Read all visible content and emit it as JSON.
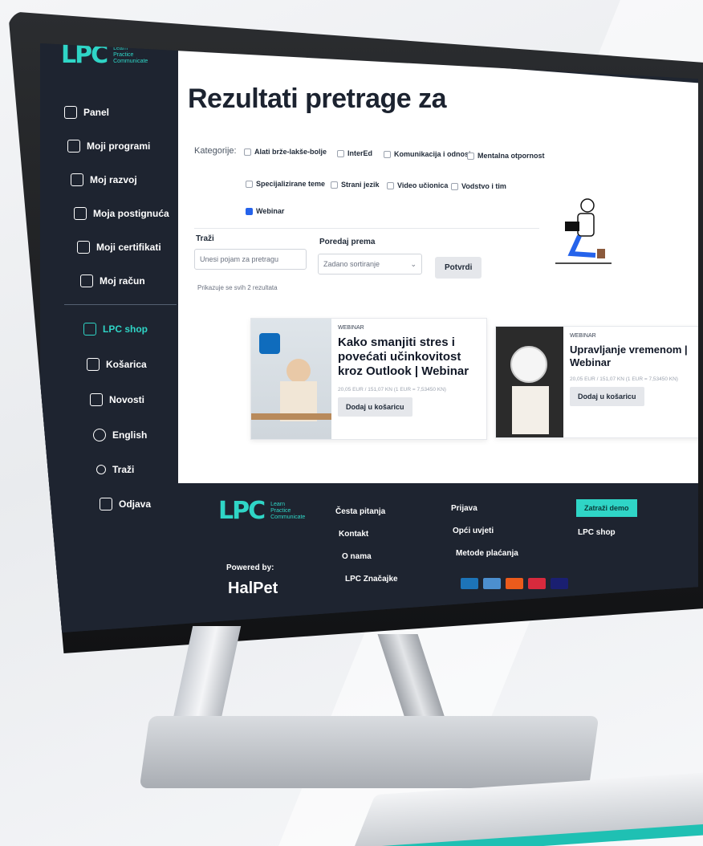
{
  "sidebar": {
    "logo_mark": "LPC",
    "logo_lines": [
      "Learn",
      "Practice",
      "Communicate"
    ],
    "items": [
      {
        "label": "Panel",
        "icon": "panel-icon"
      },
      {
        "label": "Moji programi",
        "icon": "programs-icon"
      },
      {
        "label": "Moj razvoj",
        "icon": "growth-icon"
      },
      {
        "label": "Moja postignuća",
        "icon": "achievement-icon"
      },
      {
        "label": "Moji certifikati",
        "icon": "certificate-icon"
      },
      {
        "label": "Moj račun",
        "icon": "user-icon"
      },
      {
        "label": "LPC shop",
        "icon": "shop-icon",
        "active": true
      },
      {
        "label": "Košarica",
        "icon": "cart-icon"
      },
      {
        "label": "Novosti",
        "icon": "news-icon"
      },
      {
        "label": "English",
        "icon": "globe-icon"
      },
      {
        "label": "Traži",
        "icon": "search-icon"
      },
      {
        "label": "Odjava",
        "icon": "logout-icon"
      }
    ]
  },
  "main": {
    "title": "Rezultati pretrage za",
    "filters": {
      "label": "Kategorije:",
      "options": [
        {
          "label": "Alati brže-lakše-bolje",
          "checked": false
        },
        {
          "label": "InterEd",
          "checked": false
        },
        {
          "label": "Komunikacija i odnosi",
          "checked": false
        },
        {
          "label": "Mentalna otpornost",
          "checked": false
        },
        {
          "label": "Specijalizirane teme",
          "checked": false
        },
        {
          "label": "Strani jezik",
          "checked": false
        },
        {
          "label": "Video učionica",
          "checked": false
        },
        {
          "label": "Vodstvo i tim",
          "checked": false
        },
        {
          "label": "Webinar",
          "checked": true
        }
      ]
    },
    "search": {
      "label": "Traži",
      "placeholder": "Unesi pojam za pretragu"
    },
    "sort": {
      "label": "Poredaj prema",
      "value": "Zadano sortiranje"
    },
    "submit_label": "Potvrdi",
    "results_info": "Prikazuje se svih 2 rezultata",
    "products": [
      {
        "tag": "WEBINAR",
        "title": "Kako smanjiti stres i povećati učinkovitost kroz Outlook | Webinar",
        "price": "20,05 EUR / 151,07 KN  (1 EUR = 7,53450 KN)",
        "button": "Dodaj u košaricu"
      },
      {
        "tag": "WEBINAR",
        "title": "Upravljanje vremenom | Webinar",
        "price": "20,05 EUR / 151,07 KN  (1 EUR = 7,53450 KN)",
        "button": "Dodaj u košaricu"
      }
    ]
  },
  "footer": {
    "col1": [
      "Česta pitanja",
      "Kontakt",
      "O nama",
      "LPC Značajke"
    ],
    "col2": [
      "Prijava",
      "Opći uvjeti",
      "Metode plaćanja"
    ],
    "demo_button": "Zatraži demo",
    "shop_link": "LPC shop",
    "powered_by": "Powered by:",
    "powered_brand": "HalPet",
    "payment_icons": [
      "amex-icon",
      "maestro-icon",
      "mastercard-icon",
      "diners-icon",
      "visa-icon"
    ]
  },
  "colors": {
    "accent": "#2fd5c6",
    "dark": "#1e2430",
    "checkbox": "#2563eb"
  }
}
